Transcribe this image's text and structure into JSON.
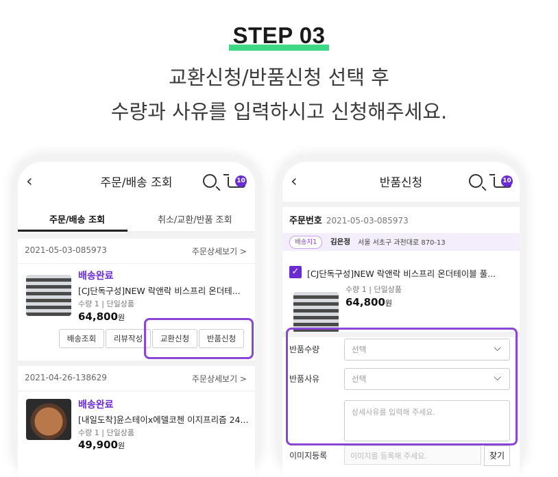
{
  "step_label": "STEP 03",
  "headline": {
    "line1": "교환신청/반품신청 선택 후",
    "line2": "수량과 사유를 입력하시고 신청해주세요."
  },
  "colors": {
    "accent": "#6a2bd2",
    "highlight": "#8a45d6",
    "step_underline": "#3fd886"
  },
  "left_screen": {
    "title": "주문/배송 조회",
    "cart_count": "10",
    "tabs": [
      "주문/배송 조회",
      "취소/교환/반품 조회"
    ],
    "orders": [
      {
        "date": "2021-05-03-085973",
        "detail_link": "주문상세보기 >",
        "status": "배송완료",
        "product": "[CJ단독구성]NEW 락앤락 비스프리 온더테...",
        "qty": "수량 1",
        "option": "단일상품",
        "price": "64,800",
        "currency": "원",
        "buttons": [
          "배송조회",
          "리뷰작성",
          "교환신청",
          "반품신청"
        ]
      },
      {
        "date": "2021-04-26-138629",
        "detail_link": "주문상세보기 >",
        "status": "배송완료",
        "product": "[내일도착]윤스테이x에델코첸 이지프리즘 24...",
        "qty": "수량 1",
        "option": "단일상품",
        "price": "49,900",
        "currency": "원"
      }
    ]
  },
  "right_screen": {
    "title": "반품신청",
    "cart_count": "10",
    "order_label": "주문번호",
    "order_number": "2021-05-03-085973",
    "address_tag": "배송지1",
    "recipient": "김은정",
    "address": "서울 서초구 과천대로 870-13",
    "checkmark": "✓",
    "product": "[CJ단독구성]NEW 락앤락 비스프리 온더테이블 풀...",
    "qty": "수량 1",
    "option": "단일상품",
    "price": "64,800",
    "currency": "원",
    "form": {
      "qty_label": "반품수량",
      "qty_placeholder": "선택",
      "reason_label": "반품사유",
      "reason_placeholder": "선택",
      "detail_placeholder": "상세사유를 입력해 주세요.",
      "image_label": "이미지등록",
      "image_placeholder": "이미지를 등록해 주세요.",
      "find_button": "찾기"
    }
  }
}
